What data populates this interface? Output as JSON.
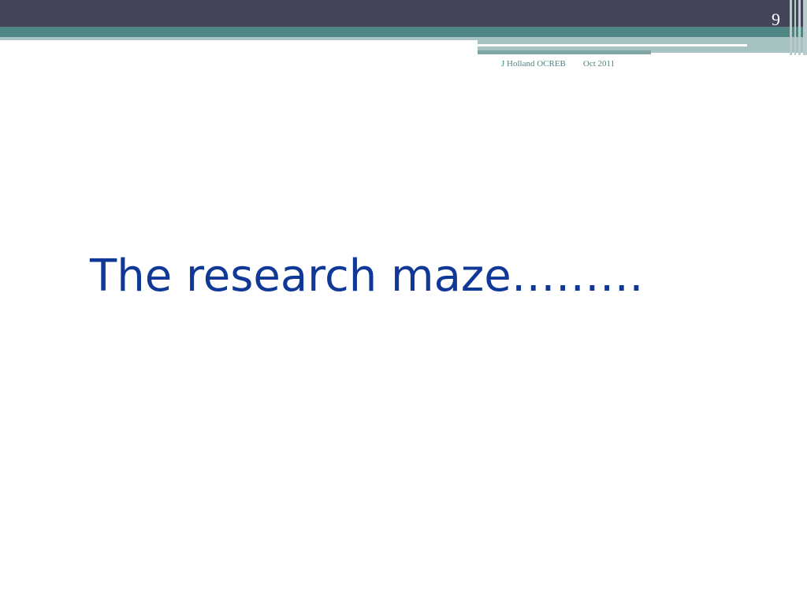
{
  "slide": {
    "number": "9",
    "author": "J Holland OCREB",
    "date": "Oct 2011",
    "title": "The research maze………"
  },
  "colors": {
    "header_dark": "#444559",
    "header_teal": "#4f8583",
    "header_light": "#a6c3c2",
    "title_blue": "#0f3897",
    "footer_text": "#4f8583"
  }
}
